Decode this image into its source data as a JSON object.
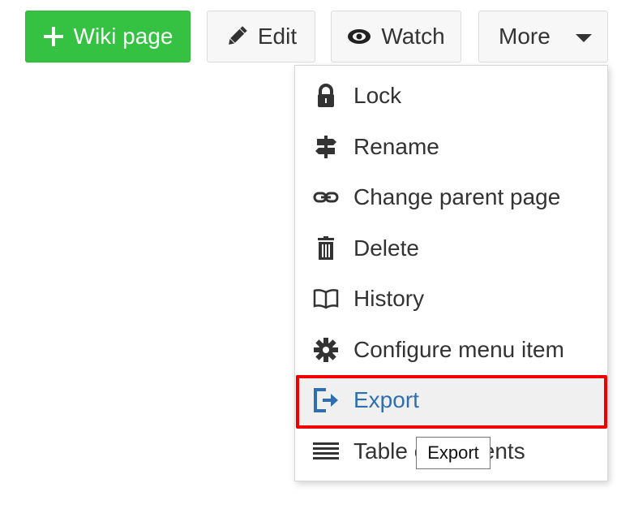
{
  "toolbar": {
    "wiki_page": {
      "label": "Wiki page",
      "icon": "plus-icon"
    },
    "edit": {
      "label": "Edit",
      "icon": "pencil-icon"
    },
    "watch": {
      "label": "Watch",
      "icon": "eye-icon"
    },
    "more": {
      "label": "More",
      "icon": "caret-down-icon"
    }
  },
  "menu": {
    "items": [
      {
        "label": "Lock",
        "icon": "lock-icon"
      },
      {
        "label": "Rename",
        "icon": "signpost-icon"
      },
      {
        "label": "Change parent page",
        "icon": "link-icon"
      },
      {
        "label": "Delete",
        "icon": "trash-icon"
      },
      {
        "label": "History",
        "icon": "book-icon"
      },
      {
        "label": "Configure menu item",
        "icon": "gear-icon"
      },
      {
        "label": "Export",
        "icon": "export-icon",
        "active": true
      },
      {
        "label": "Table of contents",
        "icon": "list-icon"
      }
    ]
  },
  "tooltip": {
    "text": "Export"
  },
  "colors": {
    "primary_green": "#35c142",
    "active_link": "#2f6fb0",
    "highlight_border": "#ee0000"
  }
}
